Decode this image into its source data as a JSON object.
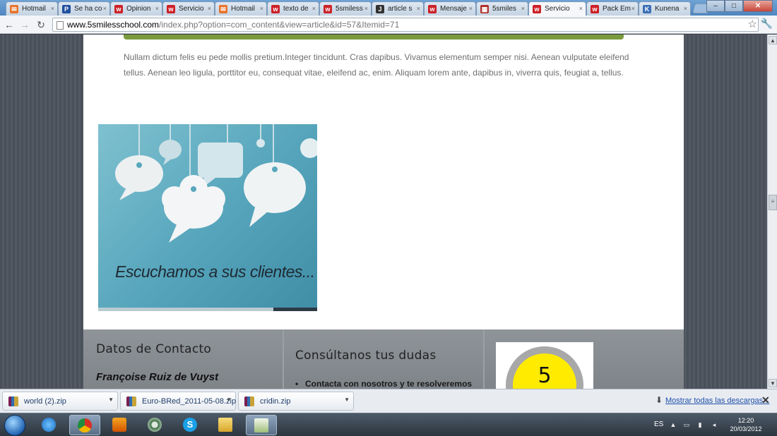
{
  "browser": {
    "tabs": [
      {
        "label": "Hotmail",
        "icon": "hotmail-icon",
        "color": "#e8732c"
      },
      {
        "label": "Se ha co",
        "icon": "paypal-icon",
        "color": "#1f4f9e"
      },
      {
        "label": "Opinion",
        "icon": "w-icon",
        "color": "#cc2127"
      },
      {
        "label": "Servicio",
        "icon": "w-icon",
        "color": "#cc2127"
      },
      {
        "label": "Hotmail",
        "icon": "hotmail-icon",
        "color": "#e8732c"
      },
      {
        "label": "texto de",
        "icon": "w-icon",
        "color": "#cc2127"
      },
      {
        "label": "5smiless",
        "icon": "w-icon",
        "color": "#cc2127"
      },
      {
        "label": "article s",
        "icon": "joomla-icon",
        "color": "#333333"
      },
      {
        "label": "Mensaje",
        "icon": "w-icon",
        "color": "#cc2127"
      },
      {
        "label": "5smiles",
        "icon": "grid-icon",
        "color": "#b0332d"
      },
      {
        "label": "Servicio",
        "icon": "w-icon",
        "color": "#cc2127",
        "active": true
      },
      {
        "label": "Pack Em",
        "icon": "w-icon",
        "color": "#cc2127"
      },
      {
        "label": "Kunena",
        "icon": "kunena-icon",
        "color": "#3b6fb6"
      }
    ],
    "tab_close": "×",
    "url_domain": "www.5smilesschool.com",
    "url_path": "/index.php?option=com_content&view=article&id=57&Itemid=71",
    "back": "←",
    "forward": "→",
    "reload": "↻",
    "star": "☆",
    "wrench": "🔧",
    "minimize": "–",
    "maximize": "□",
    "close": "✕"
  },
  "article": {
    "text": "Nullam dictum felis eu pede mollis pretium.Integer tincidunt. Cras dapibus. Vivamus elementum semper nisi. Aenean vulputate eleifend tellus. Aenean leo ligula, porttitor eu, consequat vitae, eleifend ac, enim. Aliquam lorem ante, dapibus in, viverra quis, feugiat a, tellus.",
    "image_caption": "Escuchamos a sus clientes..."
  },
  "footer": {
    "contact_title": "Datos de Contacto",
    "contact_name": "Françoise Ruiz de Vuyst",
    "questions_title": "Consúltanos tus dudas",
    "questions_item": "Contacta con nosotros y te resolveremos",
    "logo_text": "5"
  },
  "downloads": {
    "items": [
      "world (2).zip",
      "Euro-BRed_2011-05-08.zip",
      "cridin.zip"
    ],
    "show_all": "Mostrar todas las descargas...",
    "close": "✕"
  },
  "taskbar": {
    "language": "ES",
    "time": "12:20",
    "date": "20/03/2012",
    "apps": [
      "internet-explorer-icon",
      "chrome-icon",
      "media-player-icon",
      "circle-app-icon",
      "skype-icon",
      "folder-icon",
      "notepad-icon"
    ]
  }
}
